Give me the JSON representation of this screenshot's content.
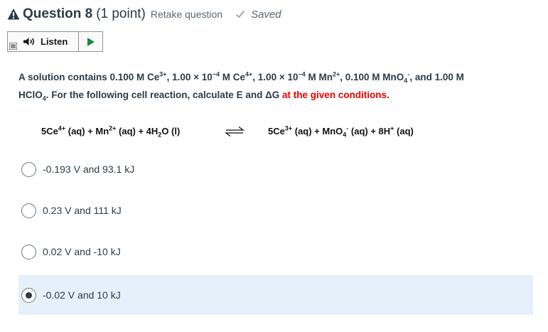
{
  "header": {
    "question_title": "Question 8",
    "points": "(1 point)",
    "retake_label": "Retake question",
    "saved_label": "Saved",
    "warning_icon": "warning-triangle-icon",
    "check_icon": "check-icon"
  },
  "listen": {
    "label": "Listen",
    "menu_icon": "menu-icon",
    "speaker_icon": "speaker-icon",
    "play_icon": "play-icon"
  },
  "question": {
    "intro": "A solution contains 0.100 M Ce",
    "ce3_charge": "3+",
    "seg2": ", 1.00 × 10",
    "exp1": "−4",
    "seg3": " M Ce",
    "ce4_charge": "4+",
    "seg4": ", 1.00 × 10",
    "exp2": "−4",
    "seg5": " M Mn",
    "mn_charge": "2+",
    "seg6": ", 0.100 M MnO",
    "mno4_sub": "4",
    "mno4_charge": "-",
    "seg7": ", and 1.00 M",
    "line2_a": "HClO",
    "hclo4_sub": "4",
    "line2_b": ". For the following cell reaction, calculate E and ΔG ",
    "highlight": "at the given conditions",
    "end": "."
  },
  "reaction": {
    "left_a": "5Ce",
    "left_a_sup": "4+",
    "left_b": " (aq) + Mn",
    "left_b_sup": "2+",
    "left_c": " (aq) + 4H",
    "left_c_sub": "2",
    "left_d": "O (l)",
    "right_a": "5Ce",
    "right_a_sup": "3+",
    "right_b": " (aq) + MnO",
    "right_b_sub": "4",
    "right_b_sup": "-",
    "right_c": " (aq) + 8H",
    "right_c_sup": "+",
    "right_d": " (aq)",
    "equilibrium_icon": "equilibrium-arrows-icon"
  },
  "options": [
    {
      "label": "-0.193 V and 93.1 kJ",
      "selected": false
    },
    {
      "label": "0.23 V and 111 kJ",
      "selected": false
    },
    {
      "label": "0.02 V and -10 kJ",
      "selected": false
    },
    {
      "label": "-0.02 V and 10 kJ",
      "selected": true
    }
  ],
  "colors": {
    "text": "#2d3b45",
    "highlight_red": "#e60000",
    "selected_bg": "#e6f0fb",
    "saved_check": "#9aa3a9"
  }
}
